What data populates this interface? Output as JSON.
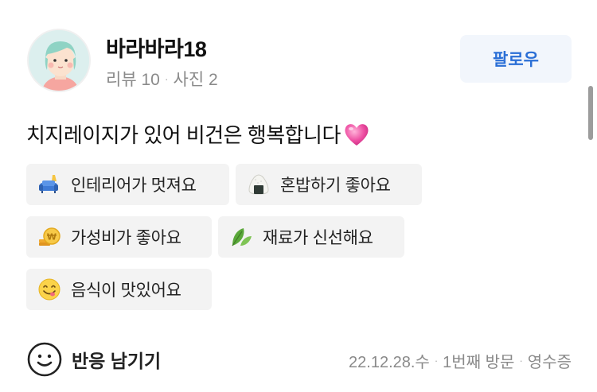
{
  "profile": {
    "username": "바라바라18",
    "reviews": "리뷰 10",
    "separator": "·",
    "photos": "사진 2",
    "follow_label": "팔로우"
  },
  "review": {
    "text": "치지레이지가 있어 비건은 행복합니다"
  },
  "keywords": [
    {
      "label": "인테리어가 멋져요",
      "icon": "sofa-icon"
    },
    {
      "label": "혼밥하기 좋아요",
      "icon": "rice-ball-icon"
    },
    {
      "label": "가성비가 좋아요",
      "icon": "coins-icon"
    },
    {
      "label": "재료가 신선해요",
      "icon": "leaf-icon"
    },
    {
      "label": "음식이 맛있어요",
      "icon": "yummy-face-icon"
    }
  ],
  "footer": {
    "reaction_label": "반응 남기기",
    "date": "22.12.28.수",
    "separator": "·",
    "visit": "1번째 방문",
    "receipt": "영수증"
  }
}
